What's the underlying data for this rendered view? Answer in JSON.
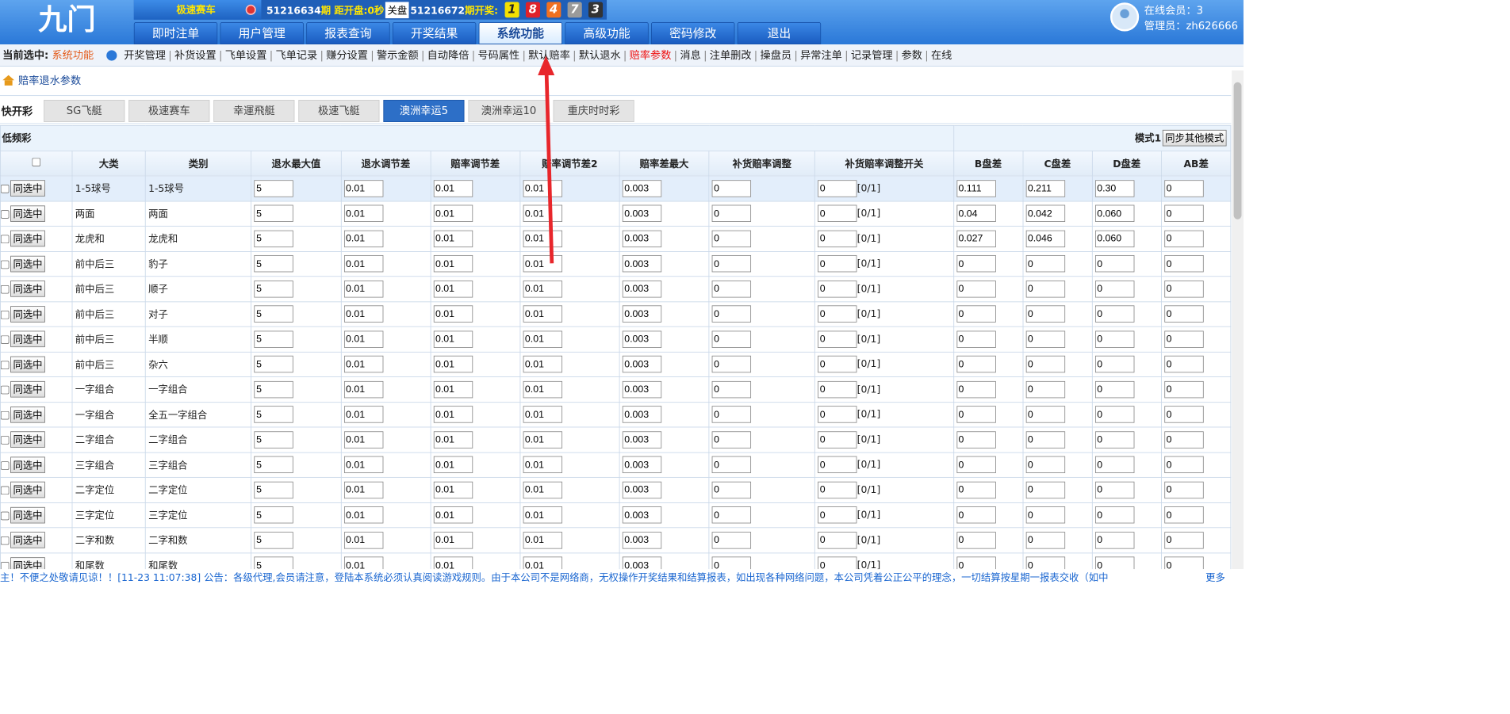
{
  "logo": "九门",
  "top": {
    "game": "极速赛车",
    "period": "51216634",
    "period_suffix": "期",
    "countdown_label": "距开盘:",
    "countdown": "0秒",
    "close_label": "关盘",
    "next_period": "51216672",
    "next_suffix": "期开奖:",
    "balls": [
      "1",
      "8",
      "4",
      "7",
      "3"
    ],
    "ball_colors": [
      "#f4e000",
      "#e0212a",
      "#f07020",
      "#9a9a9a",
      "#333333"
    ]
  },
  "tabs": [
    "即时注单",
    "用户管理",
    "报表查询",
    "开奖结果",
    "系统功能",
    "高级功能",
    "密码修改",
    "退出"
  ],
  "active_tab": "系统功能",
  "user": {
    "online": "在线会员：3",
    "admin": "管理员：zh626666"
  },
  "subnav": {
    "current_label": "当前选中:",
    "current_value": "系统功能",
    "items": [
      "开奖管理",
      "补货设置",
      "飞单设置",
      "飞单记录",
      "赚分设置",
      "警示金额",
      "自动降倍",
      "号码属性",
      "默认赔率",
      "默认退水",
      "赔率参数",
      "消息",
      "注单删改",
      "操盘员",
      "异常注单",
      "记录管理",
      "参数",
      "在线"
    ],
    "highlight": "赔率参数"
  },
  "breadcrumb": "赔率退水参数",
  "kuai": {
    "label": "快开彩",
    "tabs": [
      "SG飞艇",
      "极速赛车",
      "幸運飛艇",
      "极速飞艇",
      "澳洲幸运5",
      "澳洲幸运10",
      "重庆时时彩"
    ],
    "active": "澳洲幸运5"
  },
  "low": {
    "label": "低频彩",
    "mode_label": "模式1",
    "sync_button": "同步其他模式"
  },
  "columns": [
    "大类",
    "类别",
    "退水最大值",
    "退水调节差",
    "赔率调节差",
    "赔率调节差2",
    "赔率差最大",
    "补货赔率调整",
    "补货赔率调整开关",
    "B盘差",
    "C盘差",
    "D盘差",
    "AB差"
  ],
  "row_button": "同选中",
  "switch_hint": "[0/1]",
  "rows": [
    {
      "cat": "1-5球号",
      "sub": "1-5球号",
      "v": [
        "5",
        "0.01",
        "0.01",
        "0.01",
        "0.003",
        "0",
        "0",
        "0.111",
        "0.211",
        "0.30",
        "0"
      ]
    },
    {
      "cat": "两面",
      "sub": "两面",
      "v": [
        "5",
        "0.01",
        "0.01",
        "0.01",
        "0.003",
        "0",
        "0",
        "0.04",
        "0.042",
        "0.060",
        "0"
      ]
    },
    {
      "cat": "龙虎和",
      "sub": "龙虎和",
      "v": [
        "5",
        "0.01",
        "0.01",
        "0.01",
        "0.003",
        "0",
        "0",
        "0.027",
        "0.046",
        "0.060",
        "0"
      ]
    },
    {
      "cat": "前中后三",
      "sub": "豹子",
      "v": [
        "5",
        "0.01",
        "0.01",
        "0.01",
        "0.003",
        "0",
        "0",
        "0",
        "0",
        "0",
        "0"
      ]
    },
    {
      "cat": "前中后三",
      "sub": "顺子",
      "v": [
        "5",
        "0.01",
        "0.01",
        "0.01",
        "0.003",
        "0",
        "0",
        "0",
        "0",
        "0",
        "0"
      ]
    },
    {
      "cat": "前中后三",
      "sub": "对子",
      "v": [
        "5",
        "0.01",
        "0.01",
        "0.01",
        "0.003",
        "0",
        "0",
        "0",
        "0",
        "0",
        "0"
      ]
    },
    {
      "cat": "前中后三",
      "sub": "半顺",
      "v": [
        "5",
        "0.01",
        "0.01",
        "0.01",
        "0.003",
        "0",
        "0",
        "0",
        "0",
        "0",
        "0"
      ]
    },
    {
      "cat": "前中后三",
      "sub": "杂六",
      "v": [
        "5",
        "0.01",
        "0.01",
        "0.01",
        "0.003",
        "0",
        "0",
        "0",
        "0",
        "0",
        "0"
      ]
    },
    {
      "cat": "一字组合",
      "sub": "一字组合",
      "v": [
        "5",
        "0.01",
        "0.01",
        "0.01",
        "0.003",
        "0",
        "0",
        "0",
        "0",
        "0",
        "0"
      ]
    },
    {
      "cat": "一字组合",
      "sub": "全五一字组合",
      "v": [
        "5",
        "0.01",
        "0.01",
        "0.01",
        "0.003",
        "0",
        "0",
        "0",
        "0",
        "0",
        "0"
      ]
    },
    {
      "cat": "二字组合",
      "sub": "二字组合",
      "v": [
        "5",
        "0.01",
        "0.01",
        "0.01",
        "0.003",
        "0",
        "0",
        "0",
        "0",
        "0",
        "0"
      ]
    },
    {
      "cat": "三字组合",
      "sub": "三字组合",
      "v": [
        "5",
        "0.01",
        "0.01",
        "0.01",
        "0.003",
        "0",
        "0",
        "0",
        "0",
        "0",
        "0"
      ]
    },
    {
      "cat": "二字定位",
      "sub": "二字定位",
      "v": [
        "5",
        "0.01",
        "0.01",
        "0.01",
        "0.003",
        "0",
        "0",
        "0",
        "0",
        "0",
        "0"
      ]
    },
    {
      "cat": "三字定位",
      "sub": "三字定位",
      "v": [
        "5",
        "0.01",
        "0.01",
        "0.01",
        "0.003",
        "0",
        "0",
        "0",
        "0",
        "0",
        "0"
      ]
    },
    {
      "cat": "二字和数",
      "sub": "二字和数",
      "v": [
        "5",
        "0.01",
        "0.01",
        "0.01",
        "0.003",
        "0",
        "0",
        "0",
        "0",
        "0",
        "0"
      ]
    },
    {
      "cat": "和尾数",
      "sub": "和尾数",
      "v": [
        "5",
        "0.01",
        "0.01",
        "0.01",
        "0.003",
        "0",
        "0",
        "0",
        "0",
        "0",
        "0"
      ]
    }
  ],
  "footer": {
    "notice": "主！不便之处敬请见谅！！[11-23 11:07:38] 公告：各级代理,会员请注意，登陆本系统必须认真阅读游戏规则。由于本公司不是网络商，无权操作开奖结果和结算报表，如出现各种网络问题，本公司凭着公正公平的理念，一切结算按星期一报表交收（如中",
    "more": "更多"
  }
}
